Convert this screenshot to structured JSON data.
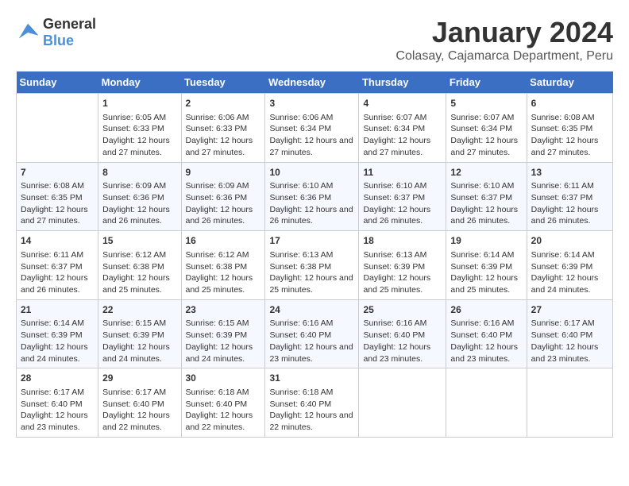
{
  "logo": {
    "text_general": "General",
    "text_blue": "Blue"
  },
  "title": "January 2024",
  "location": "Colasay, Cajamarca Department, Peru",
  "days_of_week": [
    "Sunday",
    "Monday",
    "Tuesday",
    "Wednesday",
    "Thursday",
    "Friday",
    "Saturday"
  ],
  "weeks": [
    [
      {
        "day": "",
        "sunrise": "",
        "sunset": "",
        "daylight": ""
      },
      {
        "day": "1",
        "sunrise": "6:05 AM",
        "sunset": "6:33 PM",
        "daylight": "12 hours and 27 minutes."
      },
      {
        "day": "2",
        "sunrise": "6:06 AM",
        "sunset": "6:33 PM",
        "daylight": "12 hours and 27 minutes."
      },
      {
        "day": "3",
        "sunrise": "6:06 AM",
        "sunset": "6:34 PM",
        "daylight": "12 hours and 27 minutes."
      },
      {
        "day": "4",
        "sunrise": "6:07 AM",
        "sunset": "6:34 PM",
        "daylight": "12 hours and 27 minutes."
      },
      {
        "day": "5",
        "sunrise": "6:07 AM",
        "sunset": "6:34 PM",
        "daylight": "12 hours and 27 minutes."
      },
      {
        "day": "6",
        "sunrise": "6:08 AM",
        "sunset": "6:35 PM",
        "daylight": "12 hours and 27 minutes."
      }
    ],
    [
      {
        "day": "7",
        "sunrise": "6:08 AM",
        "sunset": "6:35 PM",
        "daylight": "12 hours and 27 minutes."
      },
      {
        "day": "8",
        "sunrise": "6:09 AM",
        "sunset": "6:36 PM",
        "daylight": "12 hours and 26 minutes."
      },
      {
        "day": "9",
        "sunrise": "6:09 AM",
        "sunset": "6:36 PM",
        "daylight": "12 hours and 26 minutes."
      },
      {
        "day": "10",
        "sunrise": "6:10 AM",
        "sunset": "6:36 PM",
        "daylight": "12 hours and 26 minutes."
      },
      {
        "day": "11",
        "sunrise": "6:10 AM",
        "sunset": "6:37 PM",
        "daylight": "12 hours and 26 minutes."
      },
      {
        "day": "12",
        "sunrise": "6:10 AM",
        "sunset": "6:37 PM",
        "daylight": "12 hours and 26 minutes."
      },
      {
        "day": "13",
        "sunrise": "6:11 AM",
        "sunset": "6:37 PM",
        "daylight": "12 hours and 26 minutes."
      }
    ],
    [
      {
        "day": "14",
        "sunrise": "6:11 AM",
        "sunset": "6:37 PM",
        "daylight": "12 hours and 26 minutes."
      },
      {
        "day": "15",
        "sunrise": "6:12 AM",
        "sunset": "6:38 PM",
        "daylight": "12 hours and 25 minutes."
      },
      {
        "day": "16",
        "sunrise": "6:12 AM",
        "sunset": "6:38 PM",
        "daylight": "12 hours and 25 minutes."
      },
      {
        "day": "17",
        "sunrise": "6:13 AM",
        "sunset": "6:38 PM",
        "daylight": "12 hours and 25 minutes."
      },
      {
        "day": "18",
        "sunrise": "6:13 AM",
        "sunset": "6:39 PM",
        "daylight": "12 hours and 25 minutes."
      },
      {
        "day": "19",
        "sunrise": "6:14 AM",
        "sunset": "6:39 PM",
        "daylight": "12 hours and 25 minutes."
      },
      {
        "day": "20",
        "sunrise": "6:14 AM",
        "sunset": "6:39 PM",
        "daylight": "12 hours and 24 minutes."
      }
    ],
    [
      {
        "day": "21",
        "sunrise": "6:14 AM",
        "sunset": "6:39 PM",
        "daylight": "12 hours and 24 minutes."
      },
      {
        "day": "22",
        "sunrise": "6:15 AM",
        "sunset": "6:39 PM",
        "daylight": "12 hours and 24 minutes."
      },
      {
        "day": "23",
        "sunrise": "6:15 AM",
        "sunset": "6:39 PM",
        "daylight": "12 hours and 24 minutes."
      },
      {
        "day": "24",
        "sunrise": "6:16 AM",
        "sunset": "6:40 PM",
        "daylight": "12 hours and 23 minutes."
      },
      {
        "day": "25",
        "sunrise": "6:16 AM",
        "sunset": "6:40 PM",
        "daylight": "12 hours and 23 minutes."
      },
      {
        "day": "26",
        "sunrise": "6:16 AM",
        "sunset": "6:40 PM",
        "daylight": "12 hours and 23 minutes."
      },
      {
        "day": "27",
        "sunrise": "6:17 AM",
        "sunset": "6:40 PM",
        "daylight": "12 hours and 23 minutes."
      }
    ],
    [
      {
        "day": "28",
        "sunrise": "6:17 AM",
        "sunset": "6:40 PM",
        "daylight": "12 hours and 23 minutes."
      },
      {
        "day": "29",
        "sunrise": "6:17 AM",
        "sunset": "6:40 PM",
        "daylight": "12 hours and 22 minutes."
      },
      {
        "day": "30",
        "sunrise": "6:18 AM",
        "sunset": "6:40 PM",
        "daylight": "12 hours and 22 minutes."
      },
      {
        "day": "31",
        "sunrise": "6:18 AM",
        "sunset": "6:40 PM",
        "daylight": "12 hours and 22 minutes."
      },
      {
        "day": "",
        "sunrise": "",
        "sunset": "",
        "daylight": ""
      },
      {
        "day": "",
        "sunrise": "",
        "sunset": "",
        "daylight": ""
      },
      {
        "day": "",
        "sunrise": "",
        "sunset": "",
        "daylight": ""
      }
    ]
  ]
}
